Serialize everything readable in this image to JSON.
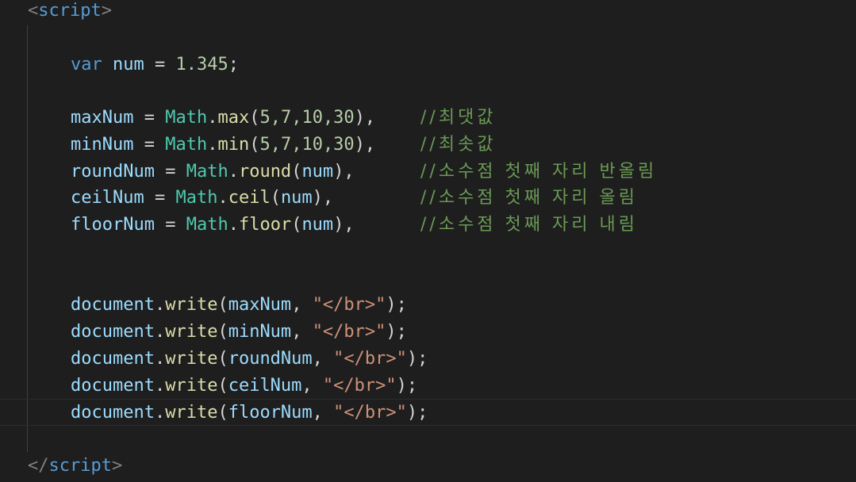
{
  "colors": {
    "background": "#1e1e1e",
    "keyword": "#569cd6",
    "variable": "#9cdcfe",
    "number": "#b5cea8",
    "class": "#4ec9b0",
    "function": "#dcdcaa",
    "string": "#ce9178",
    "comment": "#6a9955"
  },
  "open_tag": {
    "lt": "<",
    "name": "script",
    "gt": ">"
  },
  "close_tag": {
    "lt": "</",
    "name": "script",
    "gt": ">"
  },
  "decl": {
    "keyword": "var",
    "name": "num",
    "op": " = ",
    "value": "1.345",
    "end": ";"
  },
  "assignments": [
    {
      "name": "maxNum",
      "obj": "Math",
      "fn": "max",
      "args": "5,7,10,30",
      "comment": "//최댓값"
    },
    {
      "name": "minNum",
      "obj": "Math",
      "fn": "min",
      "args": "5,7,10,30",
      "comment": "//최솟값"
    },
    {
      "name": "roundNum",
      "obj": "Math",
      "fn": "round",
      "args": "num",
      "comment": "//소수점 첫째 자리 반올림"
    },
    {
      "name": "ceilNum",
      "obj": "Math",
      "fn": "ceil",
      "args": "num",
      "comment": "//소수점 첫째 자리 올림"
    },
    {
      "name": "floorNum",
      "obj": "Math",
      "fn": "floor",
      "args": "num",
      "comment": "//소수점 첫째 자리 내림"
    }
  ],
  "writes": [
    {
      "obj": "document",
      "fn": "write",
      "arg": "maxNum",
      "str": "\"</br>\""
    },
    {
      "obj": "document",
      "fn": "write",
      "arg": "minNum",
      "str": "\"</br>\""
    },
    {
      "obj": "document",
      "fn": "write",
      "arg": "roundNum",
      "str": "\"</br>\""
    },
    {
      "obj": "document",
      "fn": "write",
      "arg": "ceilNum",
      "str": "\"</br>\""
    },
    {
      "obj": "document",
      "fn": "write",
      "arg": "floorNum",
      "str": "\"</br>\""
    }
  ],
  "punct": {
    "eq": " = ",
    "dot": ".",
    "open": "(",
    "close": ")",
    "comma_end": "),",
    "sep": ", ",
    "end": ");"
  }
}
